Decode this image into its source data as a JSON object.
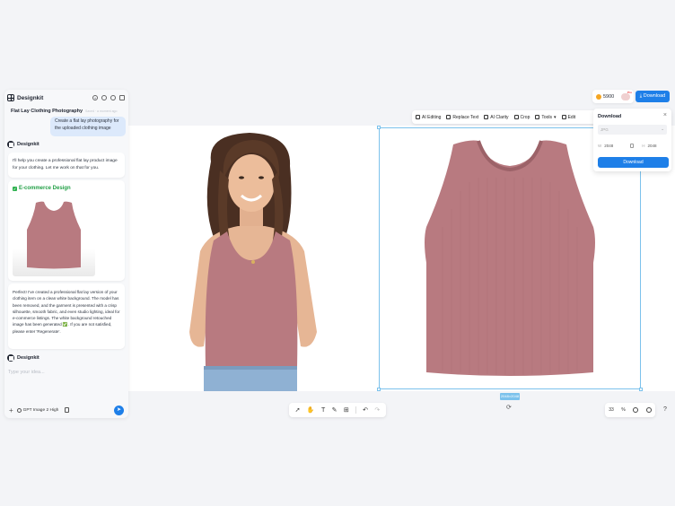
{
  "sidebar": {
    "brand": "Designkit",
    "project_title": "Flat Lay Clothing Photography",
    "project_sub": "Saved · a moment ago",
    "user_message": "Create a flat lay photography for the uploaded clothing image",
    "agent_name": "Designkit",
    "agent_message_1": "I'll help you create a professional flat lay product image for your clothing. Let me work on that for you.",
    "design_card_title": "E-commerce Design",
    "agent_message_2": "Perfect! I've created a professional flat lay version of your clothing item on a clean white background. The model has been removed, and the garment is presented with a crisp silhouette, smooth fabric, and even studio lighting, ideal for e-commerce listings. The white background retouched image has been generated ✅. If you are not satisfied, please enter 'Regenerate'.",
    "agent_name_2": "Designkit",
    "input_placeholder": "Type your idea...",
    "model_name": "GPT Image 2 High"
  },
  "header": {
    "credits": "5900",
    "download_label": "Download"
  },
  "toolbar": {
    "items": [
      "AI Editing",
      "Replace Text",
      "AI Clarity",
      "Crop",
      "Tools",
      "Edit"
    ]
  },
  "download_panel": {
    "title": "Download",
    "format": "JPG",
    "width_label": "W",
    "width": "2048",
    "height_label": "H",
    "height": "2048",
    "button": "Download"
  },
  "canvas": {
    "size_tag": "2048×2048",
    "shirt_color": "#b87a80"
  },
  "zoom": {
    "value": "33",
    "unit": "%"
  }
}
